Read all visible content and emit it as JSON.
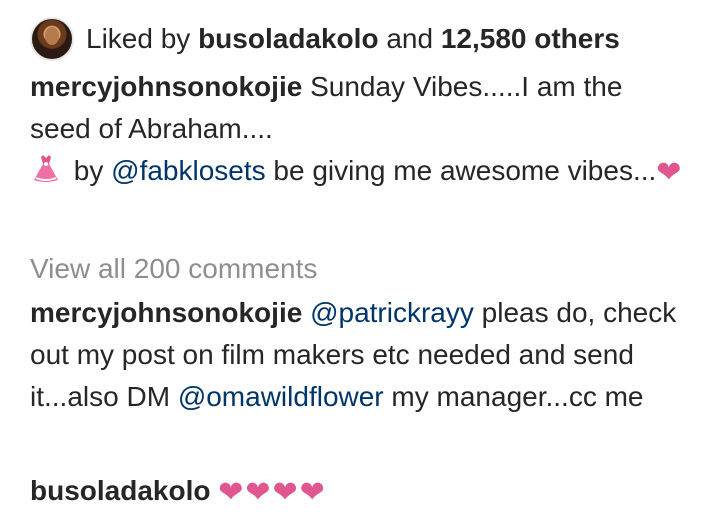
{
  "likes": {
    "prefix": "Liked by",
    "user": "busoladakolo",
    "conjunction": "and",
    "others": "12,580 others"
  },
  "caption": {
    "username": "mercyjohnsonokojie",
    "text_line1": "Sunday Vibes.....I am the seed of Abraham....",
    "by": "by",
    "mention": "@fabklosets",
    "text_line2": "be giving me awesome vibes...",
    "icons": [
      "dress-icon",
      "heart-icon"
    ]
  },
  "view_all": "View all 200 comments",
  "comments": [
    {
      "username": "mercyjohnsonokojie",
      "mention1": "@patrickrayy",
      "text1": "pleas do, check out my post on film makers etc needed and send it...also DM",
      "mention2": "@omawildflower",
      "text2": "my manager...cc me"
    },
    {
      "username": "busoladakolo",
      "hearts": [
        "❤",
        "❤",
        "❤",
        "❤"
      ]
    }
  ],
  "colors": {
    "text": "#262626",
    "mention": "#003569",
    "muted": "#8e8e8e",
    "heart": "#e0568f"
  }
}
